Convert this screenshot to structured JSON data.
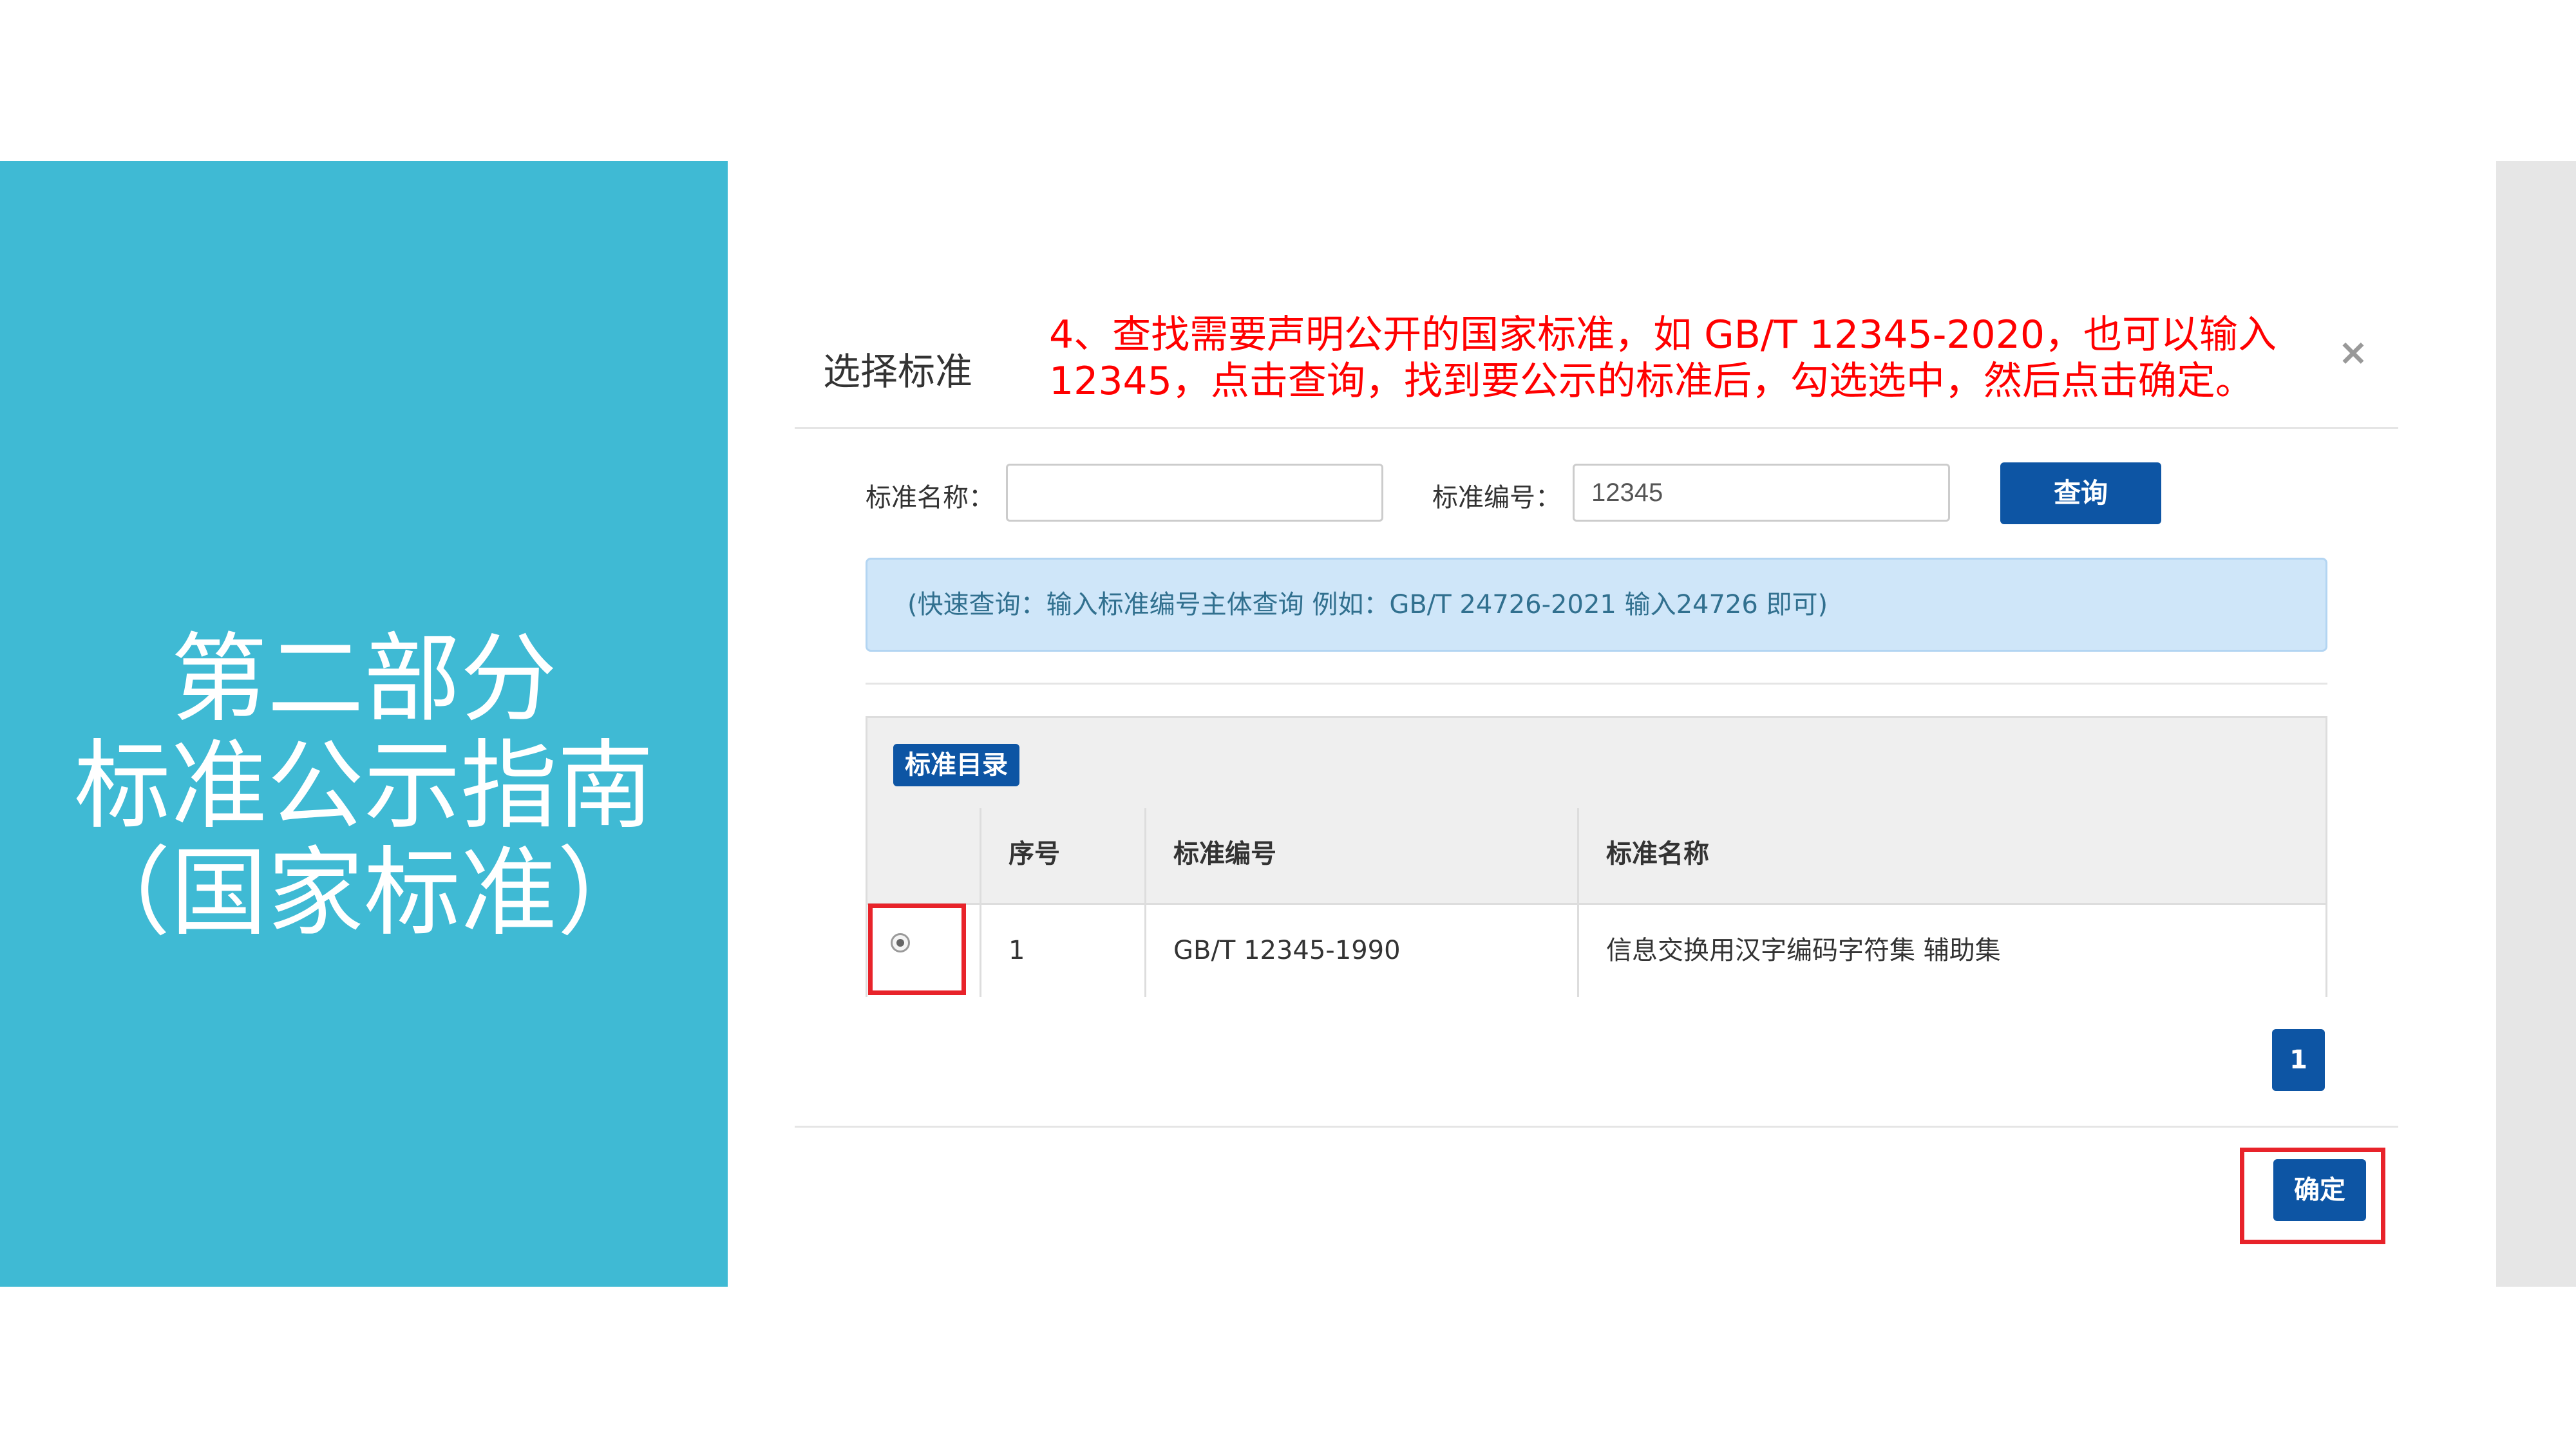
{
  "slide": {
    "title_lines": [
      "第二部分",
      "标准公示指南",
      "（国家标准）"
    ]
  },
  "dialog": {
    "title": "选择标准",
    "annotation_lines": [
      "4、查找需要声明公开的国家标准，如 GB/T 12345-2020，也可以输入",
      "12345，点击查询，找到要公示的标准后，勾选选中，然后点击确定。"
    ],
    "close_icon": "×",
    "search": {
      "name_label": "标准名称：",
      "name_value": "",
      "number_label": "标准编号：",
      "number_value": "12345",
      "button_label": "查询"
    },
    "hint": "(快速查询：输入标准编号主体查询 例如：GB/T 24726-2021 输入24726 即可)",
    "table": {
      "category_label": "标准目录",
      "headers": [
        "",
        "序号",
        "标准编号",
        "标准名称"
      ],
      "rows": [
        {
          "selected": true,
          "index": "1",
          "number": "GB/T 12345-1990",
          "name": "信息交换用汉字编码字符集 辅助集"
        }
      ]
    },
    "pagination": {
      "current_page": "1"
    },
    "confirm_label": "确定"
  },
  "colors": {
    "left_panel": "#3fbad4",
    "primary_button": "#0d55a4",
    "annotation_text": "#ff0000",
    "highlight_box": "#e8232a",
    "hint_background": "#cfe6f9"
  }
}
